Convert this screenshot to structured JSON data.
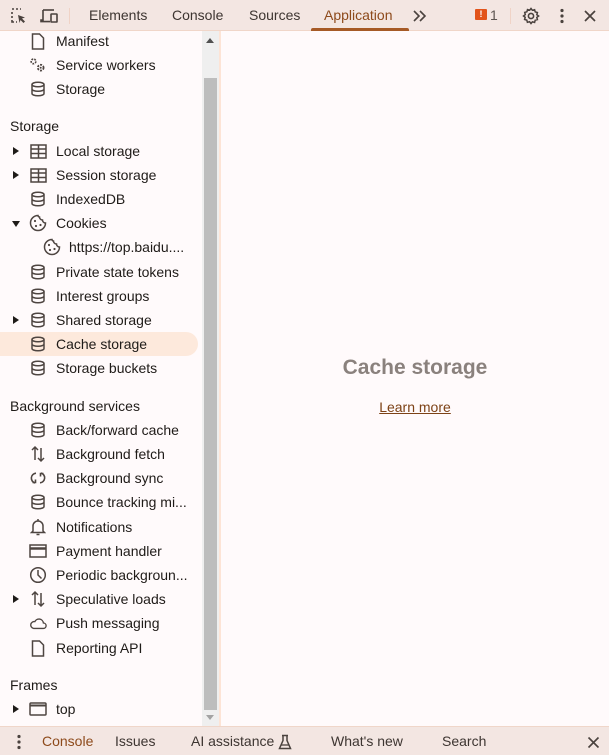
{
  "toolbar": {
    "tabs": [
      {
        "label": "Elements",
        "active": false
      },
      {
        "label": "Console",
        "active": false
      },
      {
        "label": "Sources",
        "active": false
      },
      {
        "label": "Application",
        "active": true
      }
    ],
    "more_tabs_icon": "chevron-double-right",
    "issues_count": "1",
    "issue_badge_glyph": "!",
    "accent_color": "#a65a26",
    "issue_color": "#e2541b"
  },
  "sidebar": {
    "app_items": [
      {
        "label": "Manifest",
        "icon": "file-icon"
      },
      {
        "label": "Service workers",
        "icon": "gears-icon"
      },
      {
        "label": "Storage",
        "icon": "database-icon"
      }
    ],
    "storage_heading": "Storage",
    "storage_items": [
      {
        "label": "Local storage",
        "icon": "table-icon",
        "expander": "collapsed"
      },
      {
        "label": "Session storage",
        "icon": "table-icon",
        "expander": "collapsed"
      },
      {
        "label": "IndexedDB",
        "icon": "database-icon"
      },
      {
        "label": "Cookies",
        "icon": "cookie-icon",
        "expander": "expanded"
      },
      {
        "label": "https://top.baidu....",
        "icon": "cookie-icon",
        "child": true
      },
      {
        "label": "Private state tokens",
        "icon": "database-icon"
      },
      {
        "label": "Interest groups",
        "icon": "database-icon"
      },
      {
        "label": "Shared storage",
        "icon": "database-icon",
        "expander": "collapsed"
      },
      {
        "label": "Cache storage",
        "icon": "database-icon",
        "selected": true
      },
      {
        "label": "Storage buckets",
        "icon": "database-icon"
      }
    ],
    "background_heading": "Background services",
    "background_items": [
      {
        "label": "Back/forward cache",
        "icon": "database-icon"
      },
      {
        "label": "Background fetch",
        "icon": "up-down-arrows-icon"
      },
      {
        "label": "Background sync",
        "icon": "sync-icon"
      },
      {
        "label": "Bounce tracking mi...",
        "icon": "database-icon"
      },
      {
        "label": "Notifications",
        "icon": "bell-icon"
      },
      {
        "label": "Payment handler",
        "icon": "credit-card-icon"
      },
      {
        "label": "Periodic backgroun...",
        "icon": "clock-icon"
      },
      {
        "label": "Speculative loads",
        "icon": "up-down-arrows-icon",
        "expander": "collapsed"
      },
      {
        "label": "Push messaging",
        "icon": "cloud-icon"
      },
      {
        "label": "Reporting API",
        "icon": "file-icon"
      }
    ],
    "frames_heading": "Frames",
    "frames_items": [
      {
        "label": "top",
        "icon": "window-icon",
        "expander": "collapsed"
      }
    ]
  },
  "main": {
    "title": "Cache storage",
    "learn_more": "Learn more"
  },
  "drawer": {
    "tabs": [
      {
        "label": "Console",
        "active": true
      },
      {
        "label": "Issues",
        "active": false
      },
      {
        "label": "AI assistance",
        "active": false,
        "icon": "flask-icon"
      },
      {
        "label": "What's new",
        "active": false
      },
      {
        "label": "Search",
        "active": false
      }
    ]
  }
}
